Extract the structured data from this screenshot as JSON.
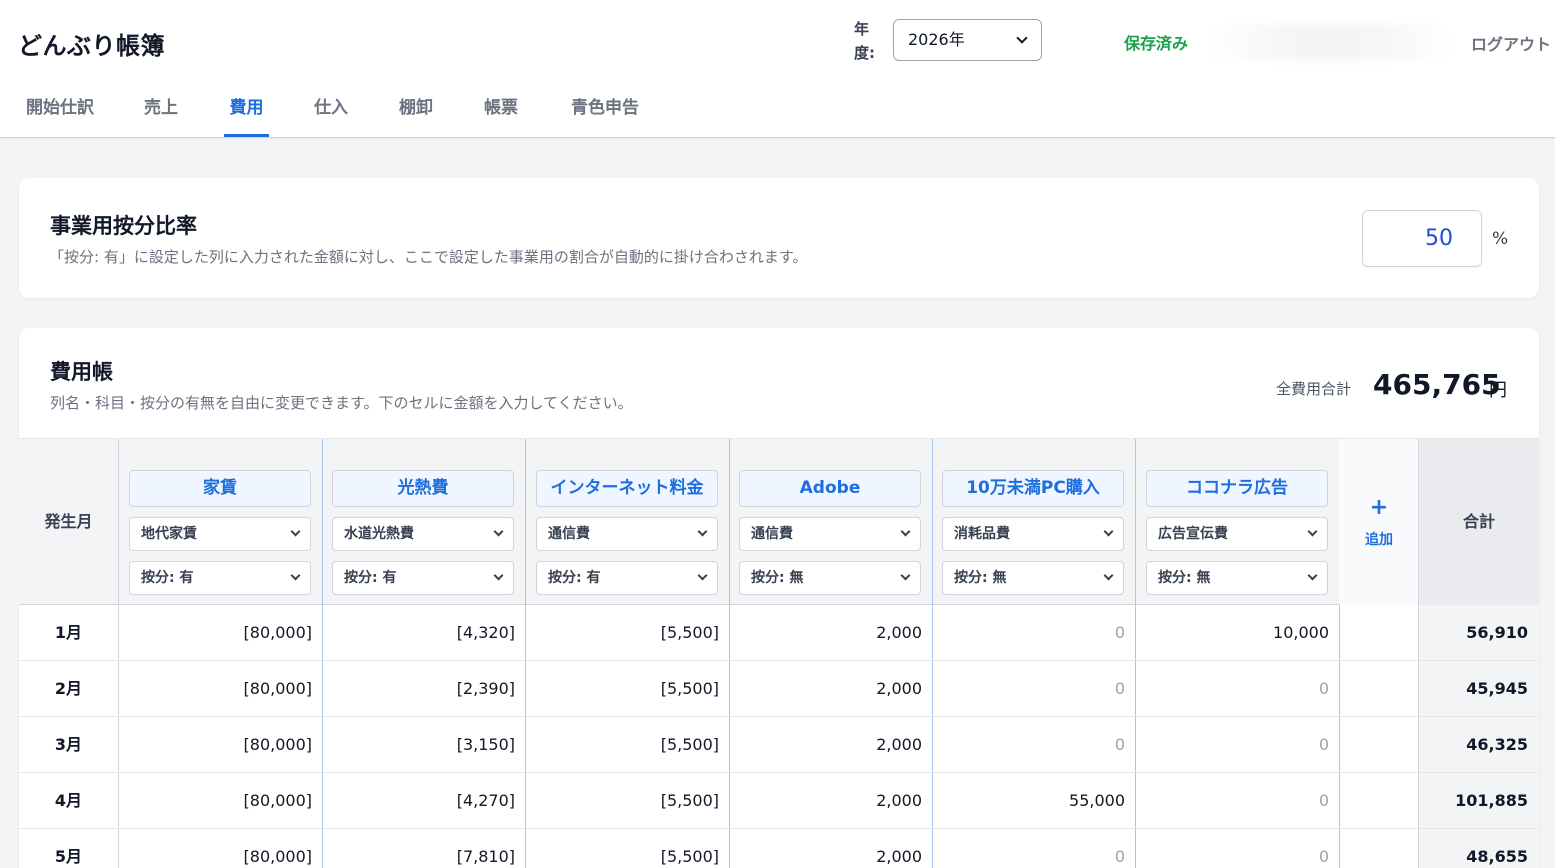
{
  "app": {
    "title": "どんぶり帳簿"
  },
  "header": {
    "year_label": "年度:",
    "year_value": "2026年",
    "save_status": "保存済み",
    "logout_label": "ログアウト"
  },
  "tabs": [
    {
      "label": "開始仕訳",
      "active": false
    },
    {
      "label": "売上",
      "active": false
    },
    {
      "label": "費用",
      "active": true
    },
    {
      "label": "仕入",
      "active": false
    },
    {
      "label": "棚卸",
      "active": false
    },
    {
      "label": "帳票",
      "active": false
    },
    {
      "label": "青色申告",
      "active": false
    }
  ],
  "ratio": {
    "title": "事業用按分比率",
    "description": "「按分: 有」に設定した列に入力された金額に対し、ここで設定した事業用の割合が自動的に掛け合わされます。",
    "value": "50",
    "unit": "%"
  },
  "ledger": {
    "title": "費用帳",
    "description": "列名・科目・按分の有無を自由に変更できます。下のセルに金額を入力してください。",
    "total_label": "全費用合計",
    "total_value": "465,765",
    "total_unit": "円",
    "month_header": "発生月",
    "add_icon": "+",
    "add_label": "追加",
    "total_header": "合計",
    "columns": [
      {
        "name": "家賃",
        "account": "地代家賃",
        "allocation": "按分: 有"
      },
      {
        "name": "光熱費",
        "account": "水道光熱費",
        "allocation": "按分: 有"
      },
      {
        "name": "インターネット料金",
        "account": "通信費",
        "allocation": "按分: 有"
      },
      {
        "name": "Adobe",
        "account": "通信費",
        "allocation": "按分: 無"
      },
      {
        "name": "10万未満PC購入",
        "account": "消耗品費",
        "allocation": "按分: 無"
      },
      {
        "name": "ココナラ広告",
        "account": "広告宣伝費",
        "allocation": "按分: 無"
      }
    ],
    "rows": [
      {
        "month": "1月",
        "cells": [
          "[80,000]",
          "[4,320]",
          "[5,500]",
          "2,000",
          "0",
          "10,000"
        ],
        "total": "56,910"
      },
      {
        "month": "2月",
        "cells": [
          "[80,000]",
          "[2,390]",
          "[5,500]",
          "2,000",
          "0",
          "0"
        ],
        "total": "45,945"
      },
      {
        "month": "3月",
        "cells": [
          "[80,000]",
          "[3,150]",
          "[5,500]",
          "2,000",
          "0",
          "0"
        ],
        "total": "46,325"
      },
      {
        "month": "4月",
        "cells": [
          "[80,000]",
          "[4,270]",
          "[5,500]",
          "2,000",
          "55,000",
          "0"
        ],
        "total": "101,885"
      },
      {
        "month": "5月",
        "cells": [
          "[80,000]",
          "[7,810]",
          "[5,500]",
          "2,000",
          "0",
          "0"
        ],
        "total": "48,655"
      }
    ]
  },
  "colors": {
    "accent": "#1d6fe0",
    "saved": "#16a34a",
    "muted": "#6b7280",
    "background": "#f3f4f6"
  },
  "icons": {
    "year_select": "chevron-down-icon",
    "add_column": "plus-icon"
  }
}
